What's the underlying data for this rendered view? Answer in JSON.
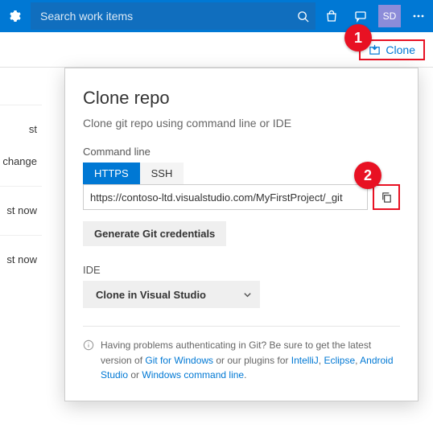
{
  "topbar": {
    "search_placeholder": "Search work items",
    "avatar_initials": "SD"
  },
  "subbar": {
    "clone_label": "Clone"
  },
  "left_hints": {
    "row1": "st change",
    "row2": "st now",
    "row3": "st now"
  },
  "callout": {
    "title": "Clone repo",
    "subtitle": "Clone git repo using command line or IDE",
    "cmdline_label": "Command line",
    "tabs": {
      "https": "HTTPS",
      "ssh": "SSH"
    },
    "url_value": "https://contoso-ltd.visualstudio.com/MyFirstProject/_git",
    "gen_creds_label": "Generate Git credentials",
    "ide_label": "IDE",
    "ide_dropdown_label": "Clone in Visual Studio",
    "help_pre": "Having problems authenticating in Git? Be sure to get the latest version of ",
    "help_git_for_windows": "Git for Windows",
    "help_mid": " or our plugins for ",
    "help_intellij": "IntelliJ",
    "help_eclipse": "Eclipse",
    "help_android_studio": "Android Studio",
    "help_or": " or ",
    "help_wcl": "Windows command line",
    "help_end": "."
  },
  "steps": {
    "one": "1",
    "two": "2"
  }
}
